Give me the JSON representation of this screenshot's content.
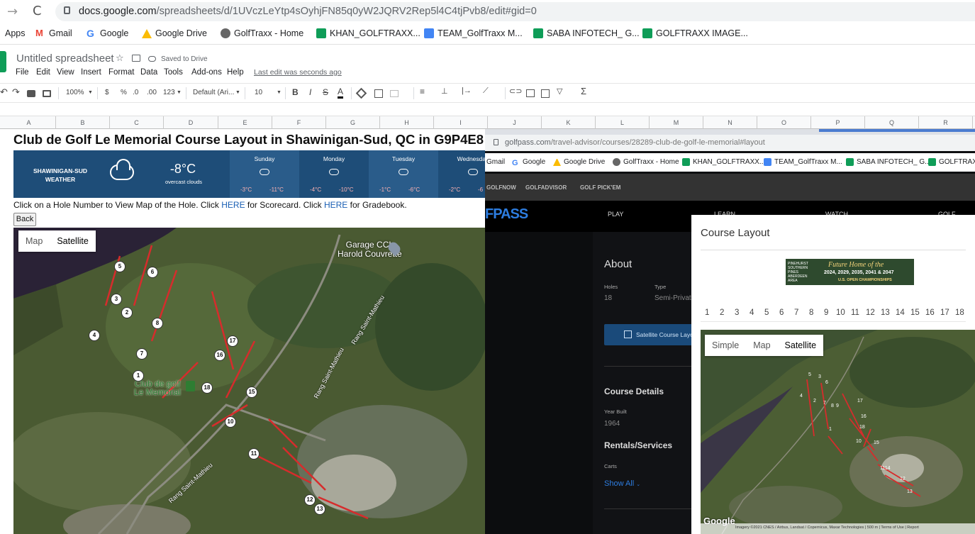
{
  "browser": {
    "nav_back": "→",
    "reload": "C",
    "url_host": "docs.google.com",
    "url_path": "/spreadsheets/d/1UVczLeYtp4sOyhjFN85q0yW2JQRV2Rep5l4C4tjPvb8/edit#gid=0",
    "bookmarks": [
      "Apps",
      "Gmail",
      "Google",
      "Google Drive",
      "GolfTraxx - Home",
      "KHAN_GOLFTRAXX...",
      "TEAM_GolfTraxx M...",
      "SABA INFOTECH_ G...",
      "GOLFTRAXX IMAGE..."
    ]
  },
  "sheets": {
    "title": "Untitled spreadsheet",
    "saved_status": "Saved to Drive",
    "menu": [
      "File",
      "Edit",
      "View",
      "Insert",
      "Format",
      "Data",
      "Tools",
      "Add-ons",
      "Help"
    ],
    "last_edit": "Last edit was seconds ago",
    "toolbar": {
      "zoom": "100%",
      "currency": "$",
      "percent": "%",
      "dec_less": ".0",
      "dec_more": ".00",
      "format": "123",
      "font": "Default (Ari...",
      "size": "10",
      "bold": "B",
      "italic": "I",
      "strike": "S",
      "text_color": "A",
      "sum": "Σ"
    },
    "columns": [
      "A",
      "B",
      "C",
      "D",
      "E",
      "F",
      "G",
      "H",
      "I",
      "J",
      "K",
      "L",
      "M",
      "N",
      "O",
      "P",
      "Q",
      "R"
    ]
  },
  "page": {
    "title": "Club de Golf Le Memorial Course Layout in Shawinigan-Sud, QC in G9P4E8",
    "weather": {
      "location_line1": "SHAWINIGAN-SUD",
      "location_line2": "WEATHER",
      "temp": "-8°C",
      "condition": "overcast clouds",
      "days": [
        {
          "name": "Sunday",
          "low": "-3°C",
          "high": "-11°C"
        },
        {
          "name": "Monday",
          "low": "-4°C",
          "high": "-10°C"
        },
        {
          "name": "Tuesday",
          "low": "-1°C",
          "high": "-6°C"
        },
        {
          "name": "Wednesday",
          "low": "-2°C",
          "high": "-6"
        }
      ]
    },
    "instructions": {
      "p1": "Click on a Hole Number to View Map of the Hole. Click ",
      "link1": "HERE",
      "p2": " for Scorecard. Click ",
      "link2": "HERE",
      "p3": " for Gradebook."
    },
    "back_button": "Back",
    "map": {
      "toggle": [
        "Map",
        "Satellite"
      ],
      "labels": {
        "garage1": "Garage CCL",
        "garage2": "Harold Couvrette",
        "club1": "Club de golf",
        "club2": "Le Memorial",
        "road1": "Rang Saint-Mathieu",
        "road2": "Rang Saint-Mathieu",
        "road3": "Rang Saint-Mathieu"
      },
      "holes": [
        "5",
        "6",
        "3",
        "2",
        "4",
        "8",
        "7",
        "1",
        "17",
        "16",
        "18",
        "15",
        "10",
        "11",
        "12",
        "13"
      ]
    }
  },
  "golfpass": {
    "url_host": "golfpass.com",
    "url_path": "/travel-advisor/courses/28289-club-de-golf-le-memorial#layout",
    "bookmarks": [
      "Gmail",
      "Google",
      "Google Drive",
      "GolfTraxx - Home",
      "KHAN_GOLFTRAXX...",
      "TEAM_GolfTraxx M...",
      "SABA INFOTECH_ G...",
      "GOLFTRAXX"
    ],
    "nav": [
      "GOLFNOW",
      "GOLFADVISOR",
      "GOLF PICK'EM"
    ],
    "logo": "FPASS",
    "menu": [
      "PLAY",
      "LEARN",
      "WATCH",
      "GOLF ADVISOR"
    ],
    "about": "About",
    "holes_label": "Holes",
    "holes_value": "18",
    "type_label": "Type",
    "type_value": "Semi-Private",
    "sat_button": "Satellite Course Layout",
    "course_details": "Course Details",
    "year_label": "Year Built",
    "year_value": "1964",
    "rentals": "Rentals/Services",
    "carts": "Carts",
    "show_all": "Show All",
    "modal": {
      "title": "Course Layout",
      "ad": {
        "line1": "PINEHURST SOUTHERN PINES ABERDEEN AREA",
        "line2": "Future Home of the",
        "line3": "2024, 2029, 2035, 2041 & 2047",
        "line4": "U.S. OPEN CHAMPIONSHIPS"
      },
      "hole_numbers": [
        "1",
        "2",
        "3",
        "4",
        "5",
        "6",
        "7",
        "8",
        "9",
        "10",
        "11",
        "12",
        "13",
        "14",
        "15",
        "16",
        "17",
        "18"
      ],
      "map_toggle": [
        "Simple",
        "Map",
        "Satellite"
      ],
      "map_labels": [
        "5",
        "3",
        "6",
        "4",
        "2",
        "7",
        "8",
        "9",
        "1",
        "17",
        "16",
        "18",
        "10",
        "15",
        "1114",
        "12",
        "13"
      ],
      "google": "Google",
      "attribution": "Imagery ©2021 CNES / Airbus, Landsat / Copernicus, Maxar Technologies | 500 m | Terms of Use | Report"
    }
  },
  "colors": {
    "sheets_green": "#0f9d58",
    "weather_bg": "#1e4d78",
    "golfpass_blue": "#2d7de0",
    "link": "#1a5fb4"
  }
}
